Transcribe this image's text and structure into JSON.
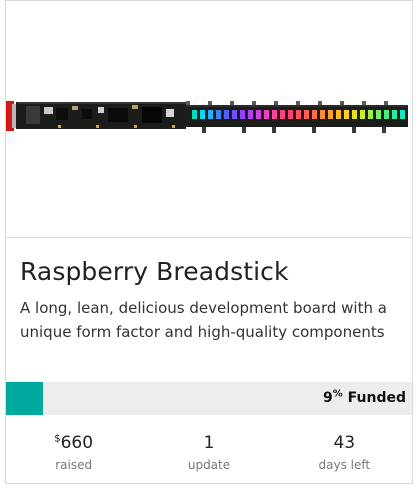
{
  "project": {
    "title": "Raspberry Breadstick",
    "description": "A long, lean, delicious development board with a unique form factor and high-quality components",
    "image_alt": "Raspberry Breadstick board"
  },
  "funding": {
    "percent_value": 9,
    "percent_symbol": "%",
    "funded_label": "Funded",
    "progress_fraction": 0.09,
    "accent_color": "#00a99d",
    "track_color": "#ededed"
  },
  "stats": [
    {
      "currency": "$",
      "value": "660",
      "label": "raised"
    },
    {
      "currency": "",
      "value": "1",
      "label": "update"
    },
    {
      "currency": "",
      "value": "43",
      "label": "days left"
    }
  ]
}
